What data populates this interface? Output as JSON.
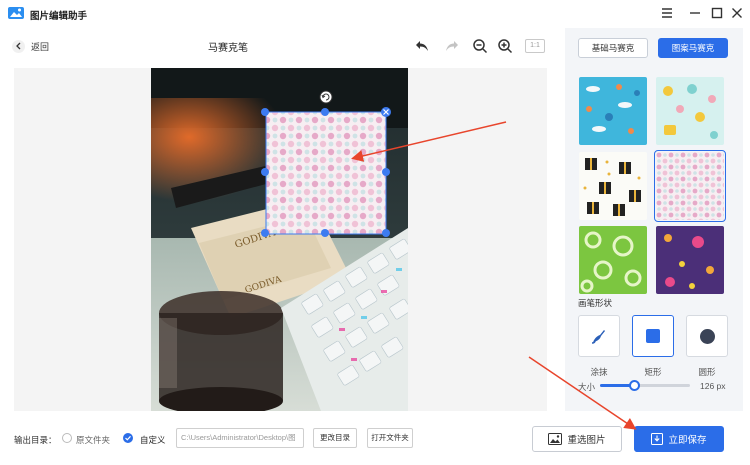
{
  "window": {
    "title": "图片编辑助手"
  },
  "toolbar": {
    "back_label": "返回",
    "page_title": "马赛克笔",
    "zoom_label": "1:1"
  },
  "panel": {
    "tabs": [
      {
        "label": "基础马赛克",
        "active": false
      },
      {
        "label": "图案马赛克",
        "active": true
      }
    ],
    "patterns": [
      {
        "icon": "ocean-pattern-icon",
        "selected": false
      },
      {
        "icon": "baby-pattern-icon",
        "selected": false
      },
      {
        "icon": "gift-pattern-icon",
        "selected": false
      },
      {
        "icon": "dots-pattern-icon",
        "selected": true
      },
      {
        "icon": "green-rings-pattern-icon",
        "selected": false
      },
      {
        "icon": "purple-dots-pattern-icon",
        "selected": false
      }
    ],
    "brush_section_label": "画笔形状",
    "brushes": [
      {
        "label": "涂抹",
        "icon": "smear-brush-icon",
        "active": false
      },
      {
        "label": "矩形",
        "icon": "rectangle-icon",
        "active": true
      },
      {
        "label": "圆形",
        "icon": "circle-icon",
        "active": false
      }
    ],
    "size_label": "大小",
    "size_value": "126 px",
    "size_fraction": 0.38
  },
  "bottom": {
    "output_label": "输出目录：",
    "option_original": "原文件夹",
    "option_custom": "自定义",
    "path_value": "C:\\Users\\Administrator\\Desktop\\图",
    "change_dir": "更改目录",
    "open_folder": "打开文件夹",
    "reselect": "重选图片",
    "save": "立即保存"
  },
  "colors": {
    "accent": "#2b6de8",
    "arrow": "#e8452c"
  }
}
